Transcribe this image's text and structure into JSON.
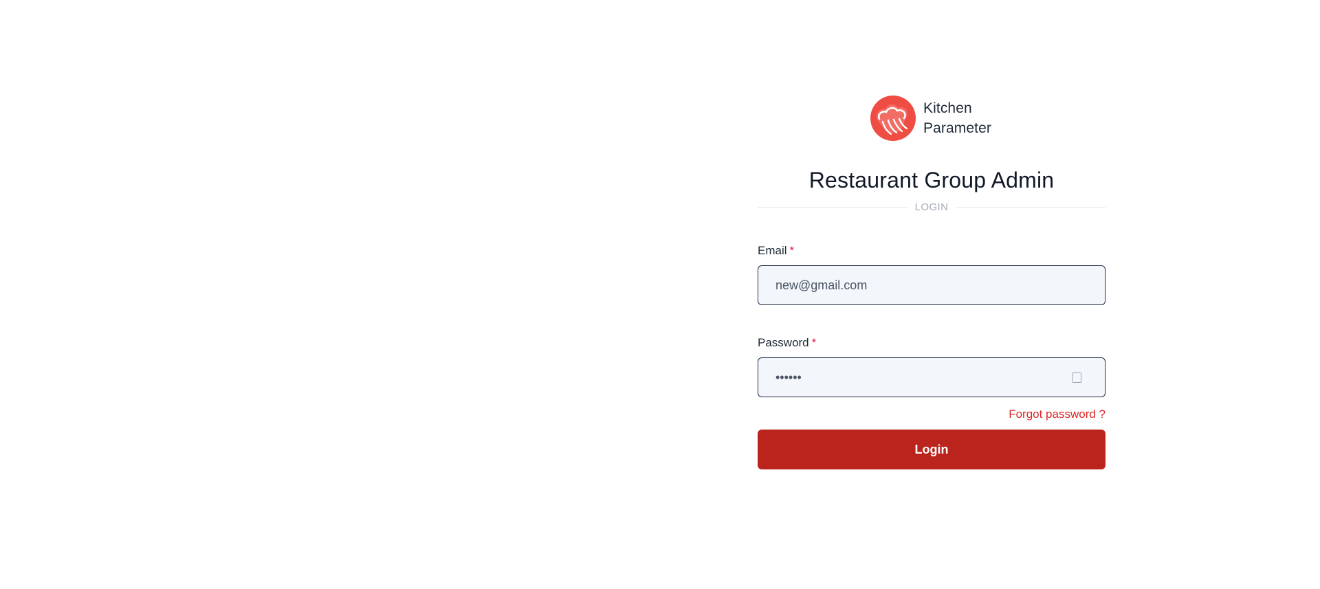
{
  "brand": {
    "name_line1": "Kitchen",
    "name_line2": "Parameter",
    "logo_icon": "chef-hat-icon",
    "logo_color": "#ef4d43"
  },
  "title": "Restaurant Group Admin",
  "divider_label": "LOGIN",
  "form": {
    "email": {
      "label": "Email",
      "required_mark": "*",
      "value": "new@gmail.com"
    },
    "password": {
      "label": "Password",
      "required_mark": "*",
      "value": "••••••",
      "toggle_icon": "eye-toggle-icon"
    },
    "forgot_password": "Forgot password ?",
    "submit_label": "Login"
  },
  "colors": {
    "accent": "#bb241c",
    "link": "#dc2626",
    "required": "#e11d48",
    "input_bg": "#f3f6fa"
  }
}
